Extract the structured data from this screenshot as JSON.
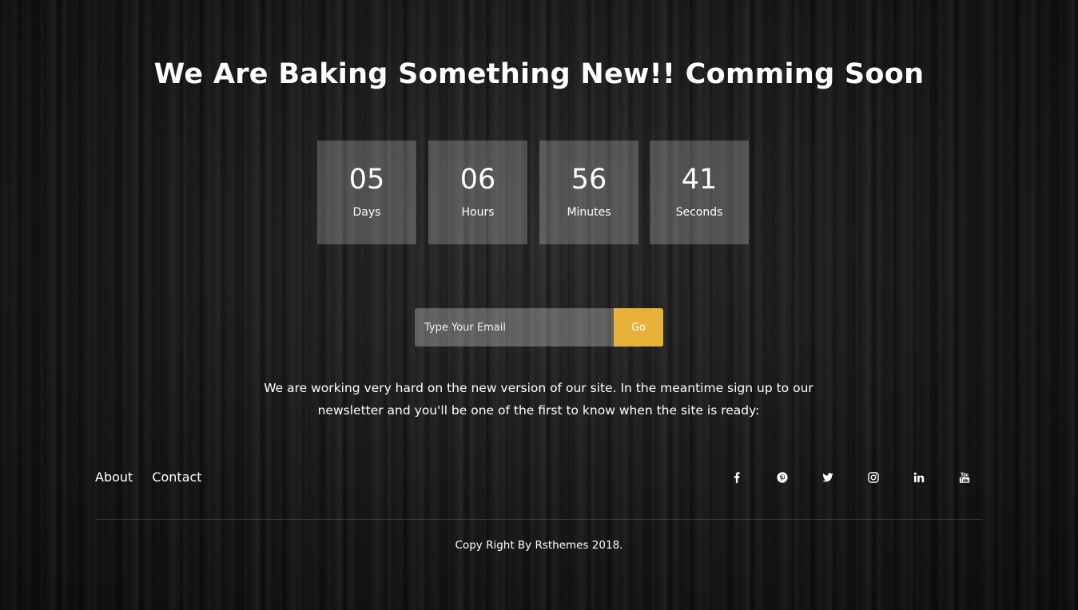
{
  "heading": "We Are Baking Something New!! Comming Soon",
  "countdown": {
    "days": {
      "value": "05",
      "label": "Days"
    },
    "hours": {
      "value": "06",
      "label": "Hours"
    },
    "minutes": {
      "value": "56",
      "label": "Minutes"
    },
    "seconds": {
      "value": "41",
      "label": "Seconds"
    }
  },
  "subscribe": {
    "placeholder": "Type Your Email",
    "value": "",
    "button_label": "Go"
  },
  "description": "We are working very hard on the new version of our site. In the meantime sign up to our newsletter and you'll be one of the first to know when the site is ready:",
  "footer": {
    "links": [
      "About",
      "Contact"
    ],
    "social_icons": [
      "facebook-icon",
      "pinterest-icon",
      "twitter-icon",
      "instagram-icon",
      "linkedin-icon",
      "youtube-icon"
    ],
    "copyright": "Copy Right By Rsthemes 2018."
  },
  "colors": {
    "accent": "#e8b23a",
    "background": "#141414",
    "text": "#ffffff"
  }
}
